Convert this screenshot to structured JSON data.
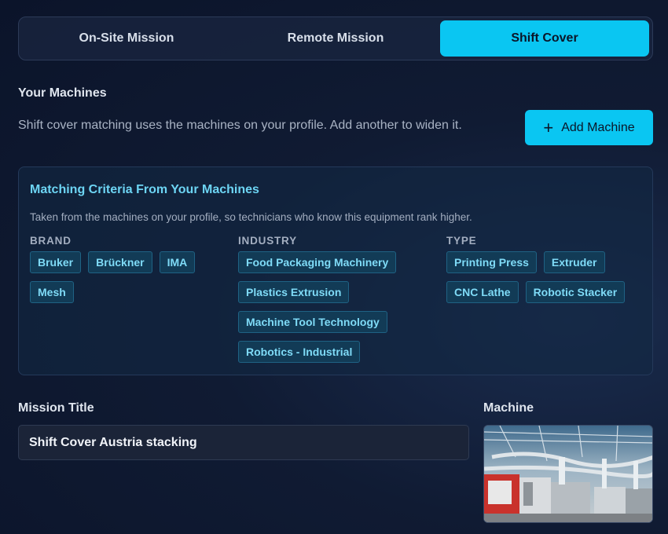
{
  "tabs": [
    {
      "label": "On-Site Mission",
      "active": false
    },
    {
      "label": "Remote Mission",
      "active": false
    },
    {
      "label": "Shift Cover",
      "active": true
    }
  ],
  "machines_section": {
    "label": "Your Machines",
    "helper": "Shift cover matching uses the machines on your profile. Add another to widen it.",
    "add_button": {
      "label": "Add Machine",
      "icon": "plus-icon"
    }
  },
  "criteria": {
    "title": "Matching Criteria From Your Machines",
    "description": "Taken from the machines on your profile, so technicians who know this equipment rank higher.",
    "brand": {
      "heading": "BRAND",
      "chips": [
        "Bruker",
        "Brückner",
        "IMA",
        "Mesh"
      ]
    },
    "industry": {
      "heading": "INDUSTRY",
      "chips": [
        "Food Packaging Machinery",
        "Plastics Extrusion",
        "Machine Tool Technology",
        "Robotics - Industrial"
      ]
    },
    "type": {
      "heading": "TYPE",
      "chips": [
        "Printing Press",
        "Extruder",
        "CNC Lathe",
        "Robotic Stacker"
      ]
    }
  },
  "mission_title": {
    "label": "Mission Title",
    "value": "Shift Cover Austria stacking"
  },
  "machine": {
    "label": "Machine",
    "image": "factory-photo"
  },
  "colors": {
    "accent": "#0ac6f2",
    "chip_text": "#7fdbf7",
    "criteria_title": "#6dd5f4"
  }
}
